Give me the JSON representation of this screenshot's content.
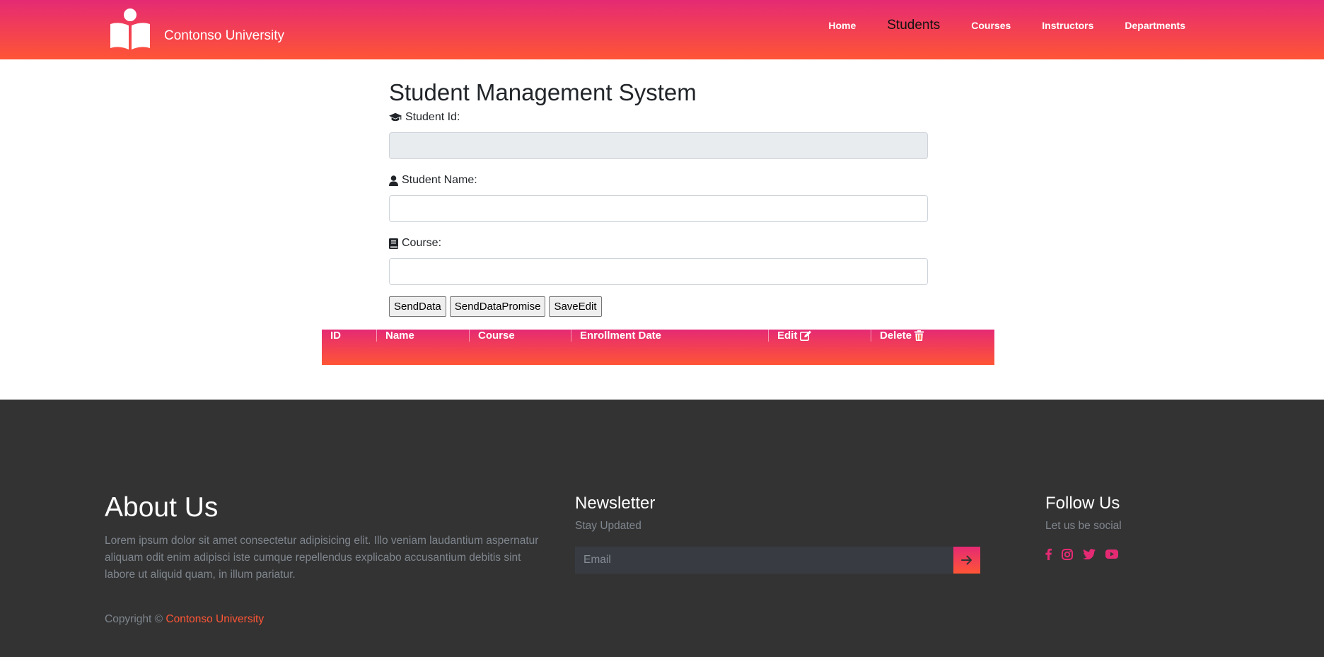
{
  "header": {
    "brand_name": "Contonso University",
    "nav": [
      {
        "label": "Home",
        "active": false
      },
      {
        "label": "Students",
        "active": true
      },
      {
        "label": "Courses",
        "active": false
      },
      {
        "label": "Instructors",
        "active": false
      },
      {
        "label": "Departments",
        "active": false
      }
    ]
  },
  "form": {
    "title": "Student Management System",
    "student_id": {
      "label": "Student Id:",
      "value": "",
      "icon": "graduation-cap-icon"
    },
    "student_name": {
      "label": "Student Name:",
      "value": "",
      "icon": "user-icon"
    },
    "course": {
      "label": "Course:",
      "value": "",
      "icon": "book-icon"
    },
    "buttons": {
      "send_data": "SendData",
      "send_data_promise": "SendDataPromise",
      "save_edit": "SaveEdit"
    }
  },
  "table": {
    "columns": {
      "id": "ID",
      "name": "Name",
      "course": "Course",
      "enrollment_date": "Enrollment Date",
      "edit": "Edit",
      "delete": "Delete"
    },
    "rows": []
  },
  "footer": {
    "about": {
      "title": "About Us",
      "text": "Lorem ipsum dolor sit amet consectetur adipisicing elit. Illo veniam laudantium aspernatur aliquam odit enim adipisci iste cumque repellendus explicabo accusantium debitis sint labore ut aliquid quam, in illum pariatur."
    },
    "copyright_prefix": "Copyright ©",
    "copyright_link": "Contonso University",
    "newsletter": {
      "title": "Newsletter",
      "subtitle": "Stay Updated",
      "email_placeholder": "Email"
    },
    "follow": {
      "title": "Follow Us",
      "subtitle": "Let us be social",
      "icons": [
        "facebook-icon",
        "instagram-icon",
        "twitter-icon",
        "youtube-icon"
      ]
    }
  },
  "colors": {
    "gradient_top": "#e52a74",
    "gradient_bottom": "#ff5535",
    "footer_bg": "#333333",
    "accent_pink": "#e52a74",
    "muted_text": "#7f868e"
  }
}
